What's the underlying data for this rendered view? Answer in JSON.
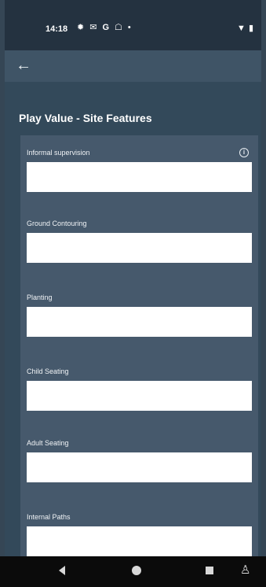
{
  "status_bar": {
    "time": "14:18",
    "icons": [
      "gear-icon",
      "message-icon",
      "google-icon",
      "android-icon",
      "dot-icon"
    ],
    "right_icons": [
      "wifi-icon",
      "battery-icon"
    ]
  },
  "app_bar": {
    "back_icon": "arrow-left-icon"
  },
  "page": {
    "title": "Play Value - Site Features"
  },
  "fields": [
    {
      "label": "Informal supervision",
      "value": "",
      "has_info": true
    },
    {
      "label": "Ground Contouring",
      "value": ""
    },
    {
      "label": "Planting",
      "value": ""
    },
    {
      "label": "Child Seating",
      "value": ""
    },
    {
      "label": "Adult Seating",
      "value": ""
    },
    {
      "label": "Internal Paths",
      "value": ""
    }
  ],
  "nav_bar": {
    "icons": [
      "back-triangle-icon",
      "home-circle-icon",
      "recents-square-icon",
      "accessibility-icon"
    ]
  }
}
